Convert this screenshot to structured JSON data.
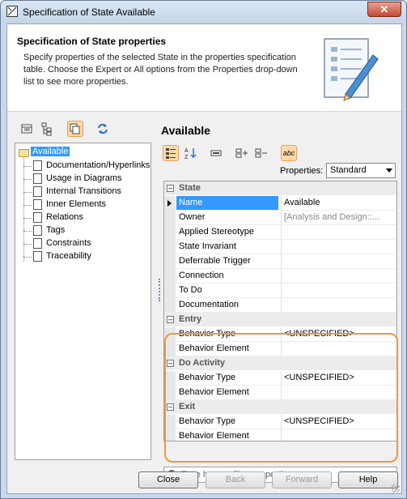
{
  "window": {
    "title": "Specification of State Available",
    "close_glyph": "✕"
  },
  "header": {
    "title": "Specification of State properties",
    "description": "Specify properties of the selected State in the properties specification table. Choose the Expert or All options from the Properties drop-down list to see more properties."
  },
  "tree": {
    "toolbar_icons": [
      "list-view-icon",
      "tree-view-icon",
      "copy-icon",
      "refresh-icon"
    ],
    "root": "Available",
    "items": [
      "Documentation/Hyperlinks",
      "Usage in Diagrams",
      "Internal Transitions",
      "Inner Elements",
      "Relations",
      "Tags",
      "Constraints",
      "Traceability"
    ]
  },
  "properties": {
    "title": "Available",
    "toolbar_icons": [
      "categorized-icon",
      "sort-alpha-icon",
      "field-icon",
      "expand-icon",
      "collapse-icon",
      "spell-check-icon"
    ],
    "spell_label": "abc",
    "filter_label": "Properties:",
    "filter_value": "Standard",
    "rows": [
      {
        "type": "group",
        "name": "State"
      },
      {
        "type": "prop",
        "name": "Name",
        "value": "Available",
        "selected": true
      },
      {
        "type": "prop",
        "name": "Owner",
        "value": "[Analysis and Design::...",
        "gray": true
      },
      {
        "type": "prop",
        "name": "Applied Stereotype",
        "value": ""
      },
      {
        "type": "prop",
        "name": "State Invariant",
        "value": ""
      },
      {
        "type": "prop",
        "name": "Deferrable Trigger",
        "value": ""
      },
      {
        "type": "prop",
        "name": "Connection",
        "value": ""
      },
      {
        "type": "prop",
        "name": "To Do",
        "value": ""
      },
      {
        "type": "prop",
        "name": "Documentation",
        "value": ""
      },
      {
        "type": "group",
        "name": "Entry"
      },
      {
        "type": "prop",
        "name": "Behavior Type",
        "value": "<UNSPECIFIED>"
      },
      {
        "type": "prop",
        "name": "Behavior Element",
        "value": ""
      },
      {
        "type": "group",
        "name": "Do Activity"
      },
      {
        "type": "prop",
        "name": "Behavior Type",
        "value": "<UNSPECIFIED>"
      },
      {
        "type": "prop",
        "name": "Behavior Element",
        "value": ""
      },
      {
        "type": "group",
        "name": "Exit"
      },
      {
        "type": "prop",
        "name": "Behavior Type",
        "value": "<UNSPECIFIED>"
      },
      {
        "type": "prop",
        "name": "Behavior Element",
        "value": ""
      }
    ],
    "filter_placeholder": "Type here to filter properties"
  },
  "footer": {
    "close": "Close",
    "back": "Back",
    "forward": "Forward",
    "help": "Help"
  },
  "colors": {
    "selection": "#3399ff",
    "highlight_border": "#e89a3e"
  }
}
